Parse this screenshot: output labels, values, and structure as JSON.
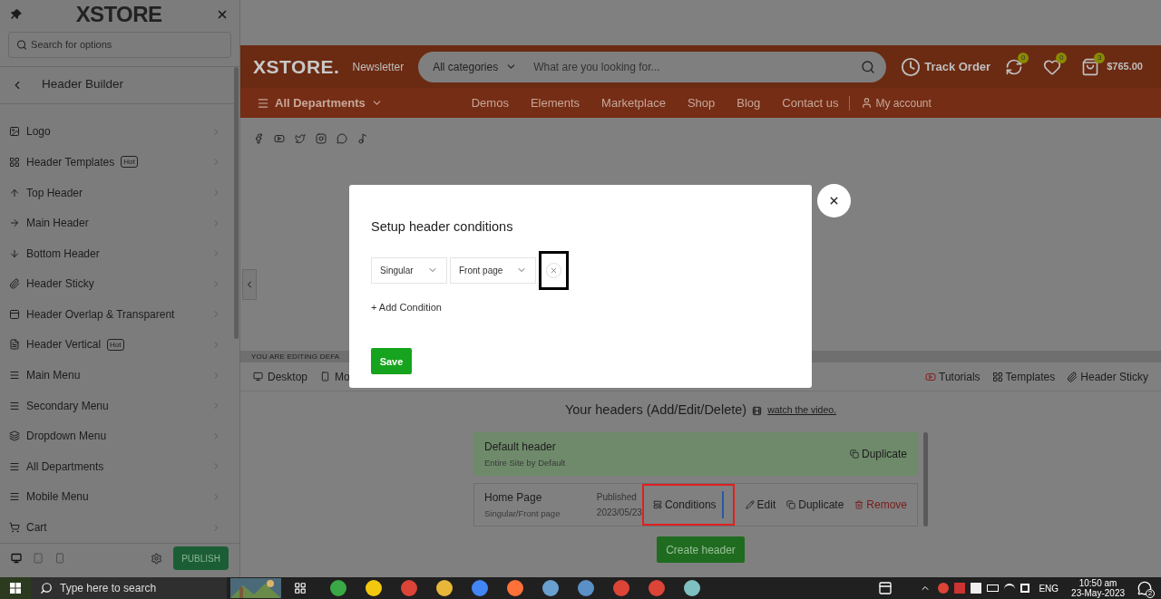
{
  "sidebar": {
    "logo": "XSTORE",
    "search": {
      "placeholder": "Search for options"
    },
    "section_title": "Header Builder",
    "items": [
      {
        "label": "Logo"
      },
      {
        "label": "Header Templates",
        "badge": "Hot"
      },
      {
        "label": "Top Header"
      },
      {
        "label": "Main Header"
      },
      {
        "label": "Bottom Header"
      },
      {
        "label": "Header Sticky"
      },
      {
        "label": "Header Overlap & Transparent"
      },
      {
        "label": "Header Vertical",
        "badge": "Hot"
      },
      {
        "label": "Main Menu"
      },
      {
        "label": "Secondary Menu"
      },
      {
        "label": "Dropdown Menu"
      },
      {
        "label": "All Departments"
      },
      {
        "label": "Mobile Menu"
      },
      {
        "label": "Cart"
      }
    ],
    "devices": [
      {
        "selected": true
      },
      {
        "selected": false
      },
      {
        "selected": false
      }
    ],
    "publish": "PUBLISH"
  },
  "site_header": {
    "logo": "XSTORE.",
    "newsletter": "Newsletter",
    "category": "All categories",
    "search_placeholder": "What are you looking for...",
    "track_order": "Track Order",
    "compare_count": "0",
    "wishlist_count": "0",
    "cart_count": "3",
    "cart_total": "$765.00",
    "departments": "All Departments",
    "nav": [
      "Demos",
      "Elements",
      "Marketplace",
      "Shop",
      "Blog",
      "Contact us"
    ],
    "account": "My account"
  },
  "editing_bar": "YOU ARE EDITING DEFA",
  "toolbar": {
    "left": [
      "Desktop",
      "Mo"
    ],
    "right": [
      "Tutorials",
      "Templates",
      "Header Sticky"
    ]
  },
  "headers": {
    "title": "Your headers (Add/Edit/Delete)",
    "video_link": "watch the video.",
    "list": [
      {
        "name": "Default header",
        "scope": "Entire Site by Default",
        "selected": true,
        "actions": [
          "Duplicate"
        ]
      },
      {
        "name": "Home Page",
        "scope": "Singular/Front page",
        "selected": false,
        "status": "Published",
        "date": "2023/05/23",
        "actions": [
          "Conditions",
          "Edit",
          "Duplicate",
          "Remove"
        ]
      }
    ],
    "create": "Create header"
  },
  "modal": {
    "title": "Setup header conditions",
    "conditions": [
      {
        "type": "Singular",
        "value": "Front page"
      }
    ],
    "add": "+ Add Condition",
    "save": "Save"
  },
  "taskbar": {
    "search": "Type here to search",
    "language": "ENG",
    "time": "10:50 am",
    "date": "23-May-2023",
    "notifications": "2"
  }
}
